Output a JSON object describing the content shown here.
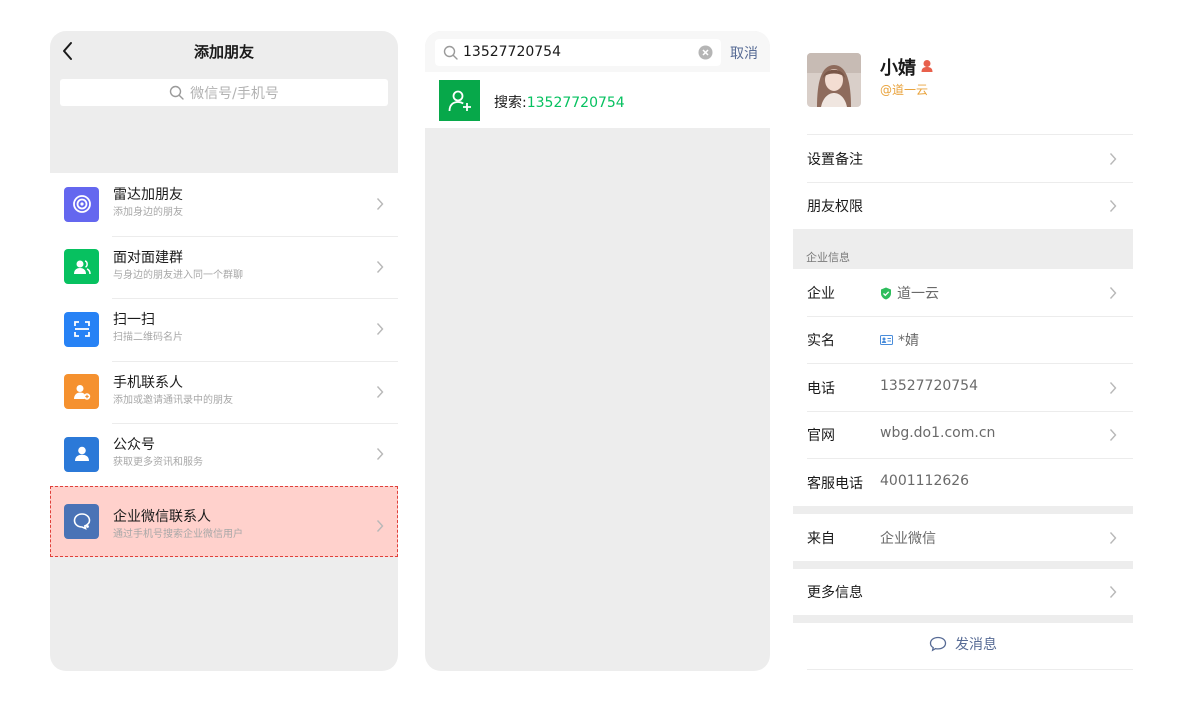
{
  "add_friend": {
    "title": "添加朋友",
    "search_placeholder": "微信号/手机号",
    "items": [
      {
        "title": "雷达加朋友",
        "subtitle": "添加身边的朋友",
        "color": "#6467ef",
        "icon": "radar-icon"
      },
      {
        "title": "面对面建群",
        "subtitle": "与身边的朋友进入同一个群聊",
        "color": "#07c160",
        "icon": "group-icon"
      },
      {
        "title": "扫一扫",
        "subtitle": "扫描二维码名片",
        "color": "#2782f5",
        "icon": "scan-icon"
      },
      {
        "title": "手机联系人",
        "subtitle": "添加或邀请通讯录中的朋友",
        "color": "#f5912f",
        "icon": "phone-contact-icon"
      },
      {
        "title": "公众号",
        "subtitle": "获取更多资讯和服务",
        "color": "#2b79d8",
        "icon": "official-account-icon"
      },
      {
        "title": "企业微信联系人",
        "subtitle": "通过手机号搜索企业微信用户",
        "color": "#4a73b6",
        "icon": "wecom-icon"
      }
    ]
  },
  "search": {
    "query": "13527720754",
    "cancel_label": "取消",
    "result_prefix": "搜索:",
    "result_value": "13527720754"
  },
  "profile": {
    "name": "小婧",
    "corp_tag": "@道一云",
    "set_remark": "设置备注",
    "friend_permission": "朋友权限",
    "section_label": "企业信息",
    "enterprise_label": "企业",
    "enterprise_value": "道一云",
    "realname_label": "实名",
    "realname_value": "*婧",
    "phone_label": "电话",
    "phone_value": "13527720754",
    "website_label": "官网",
    "website_value": "wbg.do1.com.cn",
    "service_label": "客服电话",
    "service_value": "4001112626",
    "from_label": "来自",
    "from_value": "企业微信",
    "more_info": "更多信息",
    "send_message": "发消息"
  },
  "colors": {
    "wechat_green": "#07c160",
    "link_blue": "#576b95",
    "corp_orange": "#e9a33c",
    "highlight": "#ffd1cc"
  }
}
